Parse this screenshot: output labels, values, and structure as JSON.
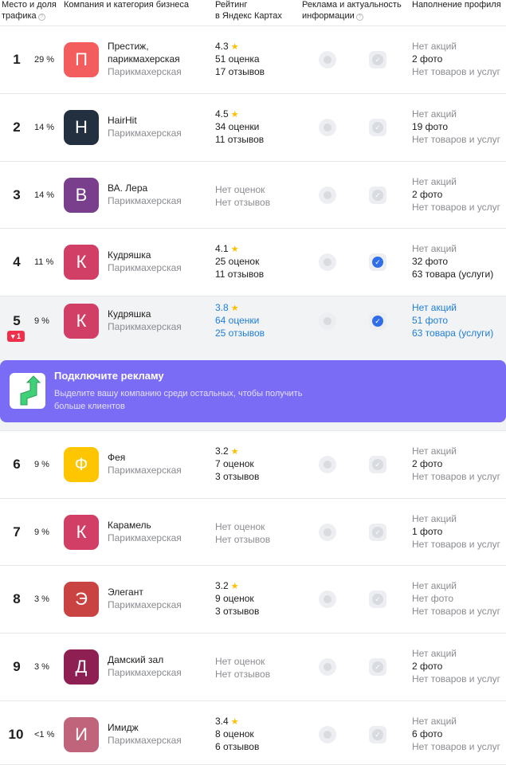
{
  "header": {
    "col_place": "Место и доля",
    "col_place_2": "трафика",
    "col_company": "Компания и категория бизнеса",
    "col_rating": "Рейтинг",
    "col_rating_2": "в Яндекс Картах",
    "col_ads": "Реклама и актуальность",
    "col_ads_2": "информации",
    "col_profile": "Наполнение профиля",
    "info_glyph": "?"
  },
  "banner": {
    "title": "Подключите рекламу",
    "text": "Выделите вашу компанию среди остальных, чтобы получить больше клиентов"
  },
  "star_glyph": "★",
  "check_glyph": "✓",
  "rows": [
    {
      "place": "1",
      "pct": "29 %",
      "letter": "П",
      "color": "#f45d5d",
      "name": "Престиж,",
      "name2": "парикмахерская",
      "category": "Парикмахерская",
      "rating": "4.3",
      "reviews1": "51 оценка",
      "reviews2": "17 отзывов",
      "verified": false,
      "p1": "Нет акций",
      "p2": "2 фото",
      "p3": "Нет товаров и услуг"
    },
    {
      "place": "2",
      "pct": "14 %",
      "letter": "H",
      "color": "#22303f",
      "name": "HairHit",
      "category": "Парикмахерская",
      "rating": "4.5",
      "reviews1": "34 оценки",
      "reviews2": "11 отзывов",
      "verified": false,
      "p1": "Нет акций",
      "p2": "19 фото",
      "p3": "Нет товаров и услуг"
    },
    {
      "place": "3",
      "pct": "14 %",
      "letter": "В",
      "color": "#7a3f8c",
      "name": "ВА. Лера",
      "category": "Парикмахерская",
      "rating": "",
      "reviews1": "Нет оценок",
      "reviews2": "Нет отзывов",
      "verified": false,
      "p1": "Нет акций",
      "p2": "2 фото",
      "p3": "Нет товаров и услуг"
    },
    {
      "place": "4",
      "pct": "11 %",
      "letter": "К",
      "color": "#d13e66",
      "name": "Кудряшка",
      "category": "Парикмахерская",
      "rating": "4.1",
      "reviews1": "25 оценок",
      "reviews2": "11 отзывов",
      "verified": true,
      "p1": "Нет акций",
      "p2": "32 фото",
      "p3": "63 товара (услуги)"
    },
    {
      "place": "5",
      "pct": "9 %",
      "delta": "▾ 1",
      "letter": "К",
      "color": "#d13e66",
      "name": "Кудряшка",
      "category": "Парикмахерская",
      "rating": "3.8",
      "reviews1": "64 оценки",
      "reviews2": "25 отзывов",
      "verified": true,
      "p1": "Нет акций",
      "p2": "51 фото",
      "p3": "63 товара (услуги)"
    },
    {
      "place": "6",
      "pct": "9 %",
      "letter": "Ф",
      "color": "#fdc600",
      "name": "Фея",
      "category": "Парикмахерская",
      "rating": "3.2",
      "reviews1": "7 оценок",
      "reviews2": "3 отзывов",
      "verified": false,
      "p1": "Нет акций",
      "p2": "2 фото",
      "p3": "Нет товаров и услуг"
    },
    {
      "place": "7",
      "pct": "9 %",
      "letter": "К",
      "color": "#d13e66",
      "name": "Карамель",
      "category": "Парикмахерская",
      "rating": "",
      "reviews1": "Нет оценок",
      "reviews2": "Нет отзывов",
      "verified": false,
      "p1": "Нет акций",
      "p2": "1 фото",
      "p3": "Нет товаров и услуг"
    },
    {
      "place": "8",
      "pct": "3 %",
      "letter": "Э",
      "color": "#c94343",
      "name": "Элегант",
      "category": "Парикмахерская",
      "rating": "3.2",
      "reviews1": "9 оценок",
      "reviews2": "3 отзывов",
      "verified": false,
      "p1": "Нет акций",
      "p2": "Нет фото",
      "p3": "Нет товаров и услуг"
    },
    {
      "place": "9",
      "pct": "3 %",
      "letter": "Д",
      "color": "#8e1f52",
      "name": "Дамский зал",
      "category": "Парикмахерская",
      "rating": "",
      "reviews1": "Нет оценок",
      "reviews2": "Нет отзывов",
      "verified": false,
      "p1": "Нет акций",
      "p2": "2 фото",
      "p3": "Нет товаров и услуг"
    },
    {
      "place": "10",
      "pct": "<1 %",
      "letter": "И",
      "color": "#c0647c",
      "name": "Имидж",
      "category": "Парикмахерская",
      "rating": "3.4",
      "reviews1": "8 оценок",
      "reviews2": "6 отзывов",
      "verified": false,
      "p1": "Нет акций",
      "p2": "6 фото",
      "p3": "Нет товаров и услуг"
    }
  ]
}
